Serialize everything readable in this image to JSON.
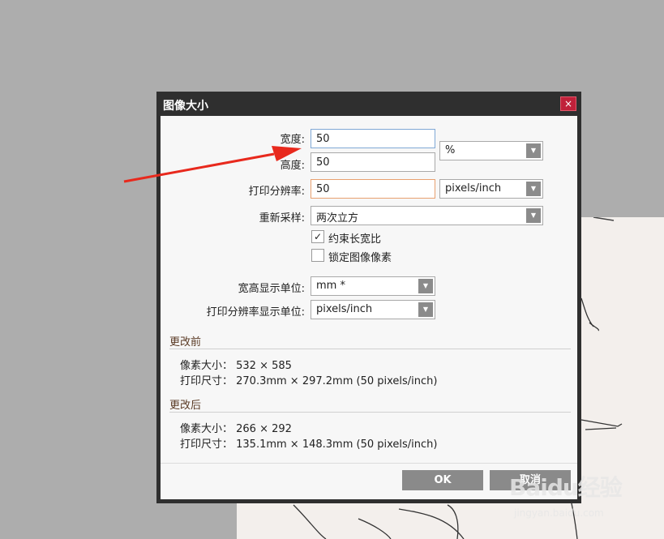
{
  "dialog": {
    "title": "图像大小",
    "close_icon": "×"
  },
  "form": {
    "width_label": "宽度:",
    "width_value": "50",
    "height_label": "高度:",
    "height_value": "50",
    "size_unit": "%",
    "resolution_label": "打印分辨率:",
    "resolution_value": "50",
    "resolution_unit": "pixels/inch",
    "resample_label": "重新采样:",
    "resample_value": "两次立方",
    "constrain_label": "约束长宽比",
    "constrain_checked": true,
    "lock_label": "锁定图像像素",
    "lock_checked": false,
    "display_unit_label": "宽高显示单位:",
    "display_unit_value": "mm *",
    "res_display_unit_label": "打印分辨率显示单位:",
    "res_display_unit_value": "pixels/inch",
    "check_mark": "✓"
  },
  "before": {
    "title": "更改前",
    "pixel_size": "像素大小： 532 × 585",
    "print_size": "打印尺寸： 270.3mm × 297.2mm (50 pixels/inch)"
  },
  "after": {
    "title": "更改后",
    "pixel_size": "像素大小： 266 × 292",
    "print_size": "打印尺寸： 135.1mm × 148.3mm (50 pixels/inch)"
  },
  "buttons": {
    "ok": "OK",
    "cancel": "取消"
  },
  "watermark": {
    "main": "Baidu经验",
    "sub": "jingyan.baidu.com"
  },
  "colors": {
    "annotation_arrow": "#e8291d",
    "button_bg": "#8a8a8a",
    "close_bg": "#c0213a"
  }
}
